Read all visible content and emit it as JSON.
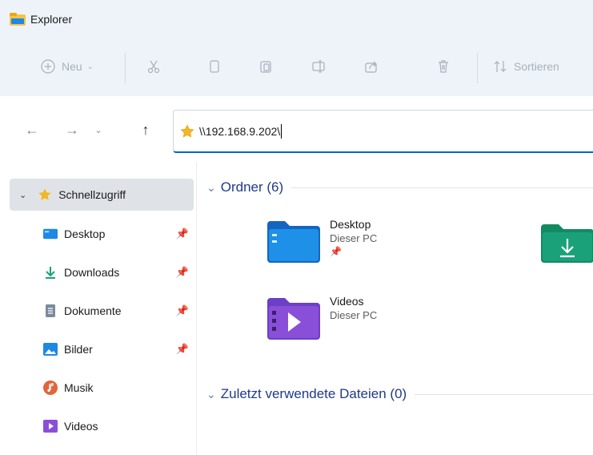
{
  "window": {
    "title": "Explorer"
  },
  "toolbar": {
    "new_label": "Neu",
    "sort_label": "Sortieren"
  },
  "address": {
    "path": "\\\\192.168.9.202\\"
  },
  "sidebar": {
    "quick_access": "Schnellzugriff",
    "items": [
      {
        "label": "Desktop",
        "pinned": true
      },
      {
        "label": "Downloads",
        "pinned": true
      },
      {
        "label": "Dokumente",
        "pinned": true
      },
      {
        "label": "Bilder",
        "pinned": true
      },
      {
        "label": "Musik",
        "pinned": false
      },
      {
        "label": "Videos",
        "pinned": false
      }
    ]
  },
  "main": {
    "folders_header": "Ordner (6)",
    "recent_header": "Zuletzt verwendete Dateien (0)",
    "folders": [
      {
        "name": "Desktop",
        "location": "Dieser PC"
      },
      {
        "name": "Videos",
        "location": "Dieser PC"
      }
    ]
  },
  "colors": {
    "accent": "#0067c0",
    "section_header": "#1f3a8a",
    "toolbar_bg": "#eef3f9",
    "selected_bg": "#dfe3e8"
  }
}
